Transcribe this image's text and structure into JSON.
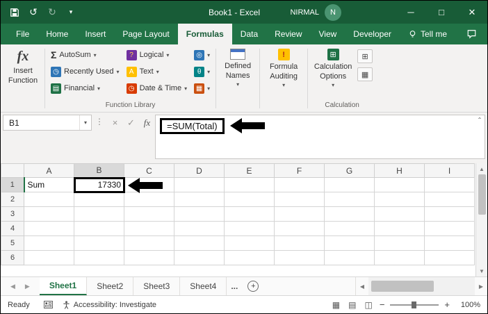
{
  "colors": {
    "titlebar_green": "#185C37",
    "ribbon_green": "#217346",
    "active_sheet_green": "#217346",
    "annotation_black": "#000000"
  },
  "titlebar": {
    "title": "Book1 - Excel",
    "user": "NIRMAL",
    "avatar": "N"
  },
  "tabs": {
    "file": "File",
    "home": "Home",
    "insert": "Insert",
    "page_layout": "Page Layout",
    "formulas": "Formulas",
    "data": "Data",
    "review": "Review",
    "view": "View",
    "developer": "Developer",
    "tell_me": "Tell me"
  },
  "ribbon": {
    "insert_function": "Insert Function",
    "autosum": "AutoSum",
    "recently_used": "Recently Used",
    "financial": "Financial",
    "logical": "Logical",
    "text": "Text",
    "date_time": "Date & Time",
    "function_library_label": "Function Library",
    "defined_names": "Defined Names",
    "formula_auditing": "Formula Auditing",
    "calculation_options": "Calculation Options",
    "calculation_label": "Calculation"
  },
  "formula_bar": {
    "name_box": "B1",
    "formula": "=SUM(Total)"
  },
  "grid": {
    "columns": [
      "A",
      "B",
      "C",
      "D",
      "E",
      "F",
      "G",
      "H",
      "I"
    ],
    "rows": [
      "1",
      "2",
      "3",
      "4",
      "5",
      "6"
    ],
    "cells": {
      "A1": "Sum",
      "B1": "17330"
    }
  },
  "sheets": {
    "tabs": [
      "Sheet1",
      "Sheet2",
      "Sheet3",
      "Sheet4"
    ],
    "overflow": "..."
  },
  "status": {
    "ready": "Ready",
    "accessibility": "Accessibility: Investigate",
    "zoom": "100%"
  }
}
